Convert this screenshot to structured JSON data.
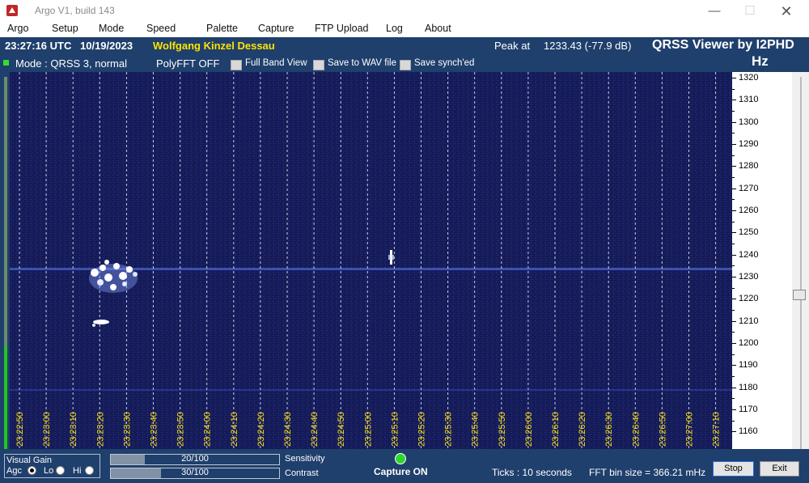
{
  "window": {
    "title": "Argo V1, build 143"
  },
  "menu": [
    "Argo",
    "Setup",
    "Mode",
    "Speed",
    "Palette",
    "Capture",
    "FTP Upload",
    "Log",
    "About"
  ],
  "info": {
    "time_utc": "23:27:16 UTC",
    "date": "10/19/2023",
    "station": "Wolfgang Kinzel Dessau",
    "peak_label": "Peak at",
    "peak_value": "1233.43 (-77.9 dB)",
    "app_name": "QRSS Viewer by I2PHD",
    "hz_label": "Hz"
  },
  "mode": {
    "mode_text": "Mode : QRSS 3, normal",
    "polyfft": "PolyFFT OFF",
    "checkboxes": [
      "Full Band View",
      "Save to WAV file",
      "Save synch'ed"
    ]
  },
  "freq_axis": {
    "unit": "Hz",
    "labels": [
      "1320",
      "1310",
      "1300",
      "1290",
      "1280",
      "1270",
      "1260",
      "1250",
      "1240",
      "1230",
      "1220",
      "1210",
      "1200",
      "1190",
      "1180",
      "1170",
      "1160"
    ]
  },
  "time_axis": {
    "labels": [
      "23:22:50",
      "23:23:00",
      "23:23:10",
      "23:23:20",
      "23:23:30",
      "23:23:40",
      "23:23:50",
      "23:24:00",
      "23:24:10",
      "23:24:20",
      "23:24:30",
      "23:24:40",
      "23:24:50",
      "23:25:00",
      "23:25:10",
      "23:25:20",
      "23:25:30",
      "23:25:40",
      "23:25:50",
      "23:26:00",
      "23:26:10",
      "23:26:20",
      "23:26:30",
      "23:26:40",
      "23:26:50",
      "23:27:00",
      "23:27:10"
    ]
  },
  "bottom": {
    "visual_gain": "Visual Gain",
    "agc": "Agc",
    "lo": "Lo",
    "hi": "Hi",
    "sensitivity_value": "20/100",
    "sensitivity_level": 0.2,
    "sensitivity_label": "Sensitivity",
    "contrast_value": "30/100",
    "contrast_level": 0.3,
    "contrast_label": "Contrast",
    "capture_status": "Capture ON",
    "ticks": "Ticks  : 10 seconds",
    "fft_bin": "FFT bin size = 366.21 mHz",
    "stop": "Stop",
    "exit": "Exit"
  },
  "colors": {
    "panel": "#1f3f6c",
    "waterfall_bg": "#141a55",
    "station": "#ffe400",
    "grid": "#ffffff"
  }
}
